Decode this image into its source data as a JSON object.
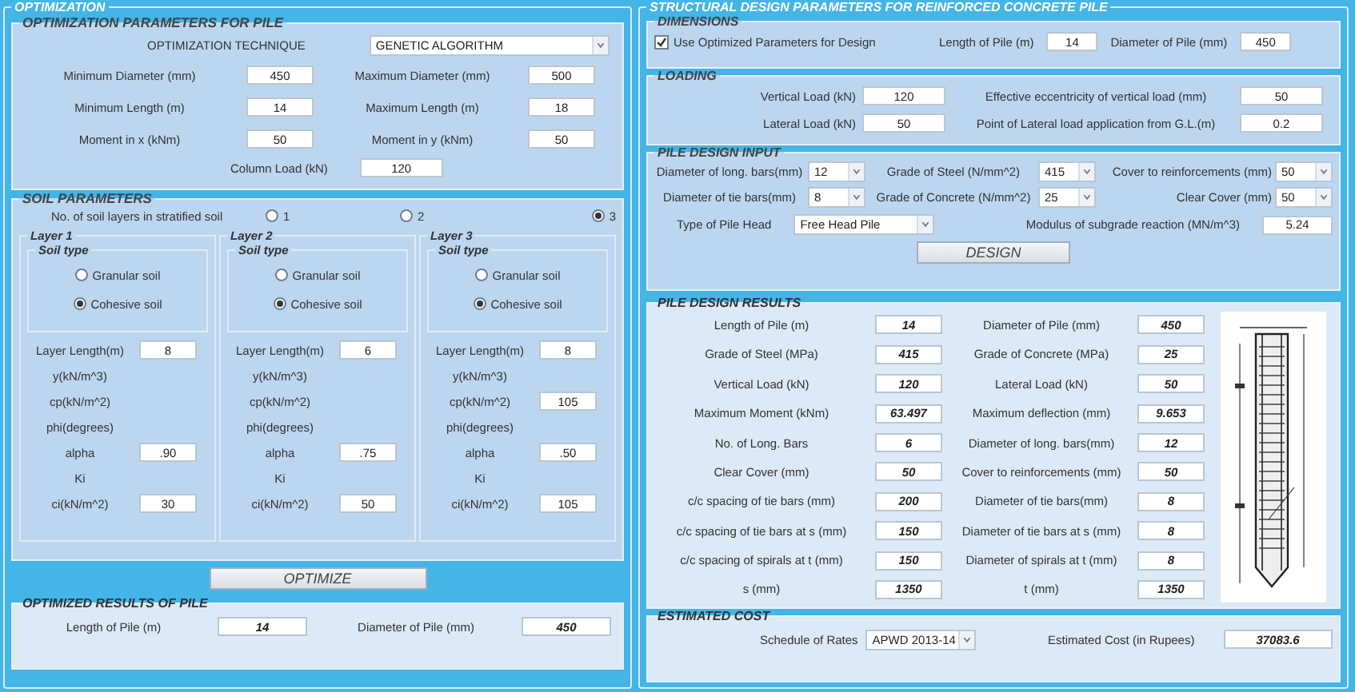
{
  "optimization": {
    "title": "OPTIMIZATION",
    "parameters": {
      "title": "OPTIMIZATION PARAMETERS  FOR PILE",
      "technique_label": "OPTIMIZATION TECHNIQUE",
      "technique": "GENETIC ALGORITHM",
      "fields": [
        {
          "label": "Minimum Diameter (mm)",
          "value": "450"
        },
        {
          "label": "Maximum Diameter (mm)",
          "value": "500"
        },
        {
          "label": "Minimum Length (m)",
          "value": "14"
        },
        {
          "label": "Maximum Length (m)",
          "value": "18"
        },
        {
          "label": "Moment in x (kNm)",
          "value": "50"
        },
        {
          "label": "Moment in y (kNm)",
          "value": "50"
        }
      ],
      "column_load": {
        "label": "Column Load (kN)",
        "value": "120"
      }
    },
    "soil": {
      "title": "SOIL PARAMETERS",
      "layers_label": "No. of soil layers in stratified soil",
      "layer_counts": [
        {
          "label": "1",
          "selected": false
        },
        {
          "label": "2",
          "selected": false
        },
        {
          "label": "3",
          "selected": true
        }
      ],
      "layers": [
        {
          "title": "Layer 1",
          "soil_type_title": "Soil type",
          "soil_types": [
            {
              "label": "Granular  soil",
              "selected": false
            },
            {
              "label": "Cohesive soil",
              "selected": true
            }
          ],
          "properties": [
            {
              "label": "Layer Length(m)",
              "value": "8"
            },
            {
              "label": "y(kN/m^3)"
            },
            {
              "label": "cp(kN/m^2)"
            },
            {
              "label": "phi(degrees)"
            },
            {
              "label": "alpha",
              "value": ".90"
            },
            {
              "label": "Ki"
            },
            {
              "label": "ci(kN/m^2)",
              "value": "30"
            }
          ]
        },
        {
          "title": "Layer 2",
          "soil_type_title": "Soil type",
          "soil_types": [
            {
              "label": "Granular  soil",
              "selected": false
            },
            {
              "label": "Cohesive soil",
              "selected": true
            }
          ],
          "properties": [
            {
              "label": "Layer Length(m)",
              "value": "6"
            },
            {
              "label": "y(kN/m^3)"
            },
            {
              "label": "cp(kN/m^2)"
            },
            {
              "label": "phi(degrees)"
            },
            {
              "label": "alpha",
              "value": ".75"
            },
            {
              "label": "Ki"
            },
            {
              "label": "ci(kN/m^2)",
              "value": "50"
            }
          ]
        },
        {
          "title": "Layer 3",
          "soil_type_title": "Soil type",
          "soil_types": [
            {
              "label": "Granular  soil",
              "selected": false
            },
            {
              "label": "Cohesive soil",
              "selected": true
            }
          ],
          "properties": [
            {
              "label": "Layer Length(m)",
              "value": "8"
            },
            {
              "label": "y(kN/m^3)"
            },
            {
              "label": "cp(kN/m^2)",
              "value": "105"
            },
            {
              "label": "phi(degrees)"
            },
            {
              "label": "alpha",
              "value": ".50"
            },
            {
              "label": "Ki"
            },
            {
              "label": "ci(kN/m^2)",
              "value": "105"
            }
          ]
        }
      ]
    },
    "optimize_button": "OPTIMIZE",
    "results": {
      "title": "OPTIMIZED RESULTS OF PILE",
      "fields": [
        {
          "label": "Length of Pile (m)",
          "value": "14"
        },
        {
          "label": "Diameter of Pile (mm)",
          "value": "450"
        }
      ]
    }
  },
  "design": {
    "title": "STRUCTURAL DESIGN PARAMETERS FOR REINFORCED CONCRETE PILE",
    "dimensions": {
      "title": "DIMENSIONS",
      "use_optimized": {
        "label": "Use Optimized Parameters for Design",
        "checked": true
      },
      "fields": [
        {
          "label": "Length of Pile (m)",
          "value": "14"
        },
        {
          "label": "Diameter of Pile (mm)",
          "value": "450"
        }
      ]
    },
    "loading": {
      "title": "LOADING",
      "fields": [
        {
          "label": "Vertical Load (kN)",
          "value": "120"
        },
        {
          "label": "Effective eccentricity of vertical load (mm)",
          "value": "50"
        },
        {
          "label": "Lateral Load (kN)",
          "value": "50"
        },
        {
          "label": "Point of Lateral load application from G.L.(m)",
          "value": "0.2"
        }
      ]
    },
    "input": {
      "title": "PILE DESIGN INPUT",
      "selects": [
        {
          "label": "Diameter of long. bars(mm)",
          "value": "12"
        },
        {
          "label": "Grade of Steel (N/mm^2)",
          "value": "415"
        },
        {
          "label": "Cover to reinforcements (mm)",
          "value": "50"
        },
        {
          "label": "Diameter of tie bars(mm)",
          "value": "8"
        },
        {
          "label": "Grade of Concrete (N/mm^2)",
          "value": "25"
        },
        {
          "label": "Clear Cover (mm)",
          "value": "50"
        }
      ],
      "pile_head": {
        "label": "Type of Pile Head",
        "value": "Free Head Pile"
      },
      "modulus": {
        "label": "Modulus of subgrade reaction (MN/m^3)",
        "value": "5.24"
      },
      "design_button": "DESIGN"
    },
    "results": {
      "title": "PILE DESIGN RESULTS",
      "fields": [
        {
          "label": "Length of Pile (m)",
          "value": "14"
        },
        {
          "label": "Diameter of Pile (mm)",
          "value": "450"
        },
        {
          "label": "Grade of Steel (MPa)",
          "value": "415"
        },
        {
          "label": "Grade of Concrete (MPa)",
          "value": "25"
        },
        {
          "label": "Vertical Load (kN)",
          "value": "120"
        },
        {
          "label": "Lateral Load (kN)",
          "value": "50"
        },
        {
          "label": "Maximum Moment (kNm)",
          "value": "63.497"
        },
        {
          "label": "Maximum deflection (mm)",
          "value": "9.653"
        },
        {
          "label": "No. of Long. Bars",
          "value": "6"
        },
        {
          "label": "Diameter of long. bars(mm)",
          "value": "12"
        },
        {
          "label": "Clear Cover (mm)",
          "value": "50"
        },
        {
          "label": "Cover to reinforcements (mm)",
          "value": "50"
        },
        {
          "label": "c/c spacing of tie bars (mm)",
          "value": "200"
        },
        {
          "label": "Diameter of tie bars(mm)",
          "value": "8"
        },
        {
          "label": "c/c spacing of tie bars at s (mm)",
          "value": "150"
        },
        {
          "label": "Diameter of tie bars at s (mm)",
          "value": "8"
        },
        {
          "label": "c/c spacing of spirals at t (mm)",
          "value": "150"
        },
        {
          "label": "Diameter of spirals at t (mm)",
          "value": "8"
        },
        {
          "label": "s (mm)",
          "value": "1350"
        },
        {
          "label": "t (mm)",
          "value": "1350"
        }
      ]
    },
    "cost": {
      "title": "ESTIMATED COST",
      "schedule": {
        "label": "Schedule of Rates",
        "value": "APWD 2013-14"
      },
      "estimate": {
        "label": "Estimated Cost (in Rupees)",
        "value": "37083.6"
      }
    }
  }
}
